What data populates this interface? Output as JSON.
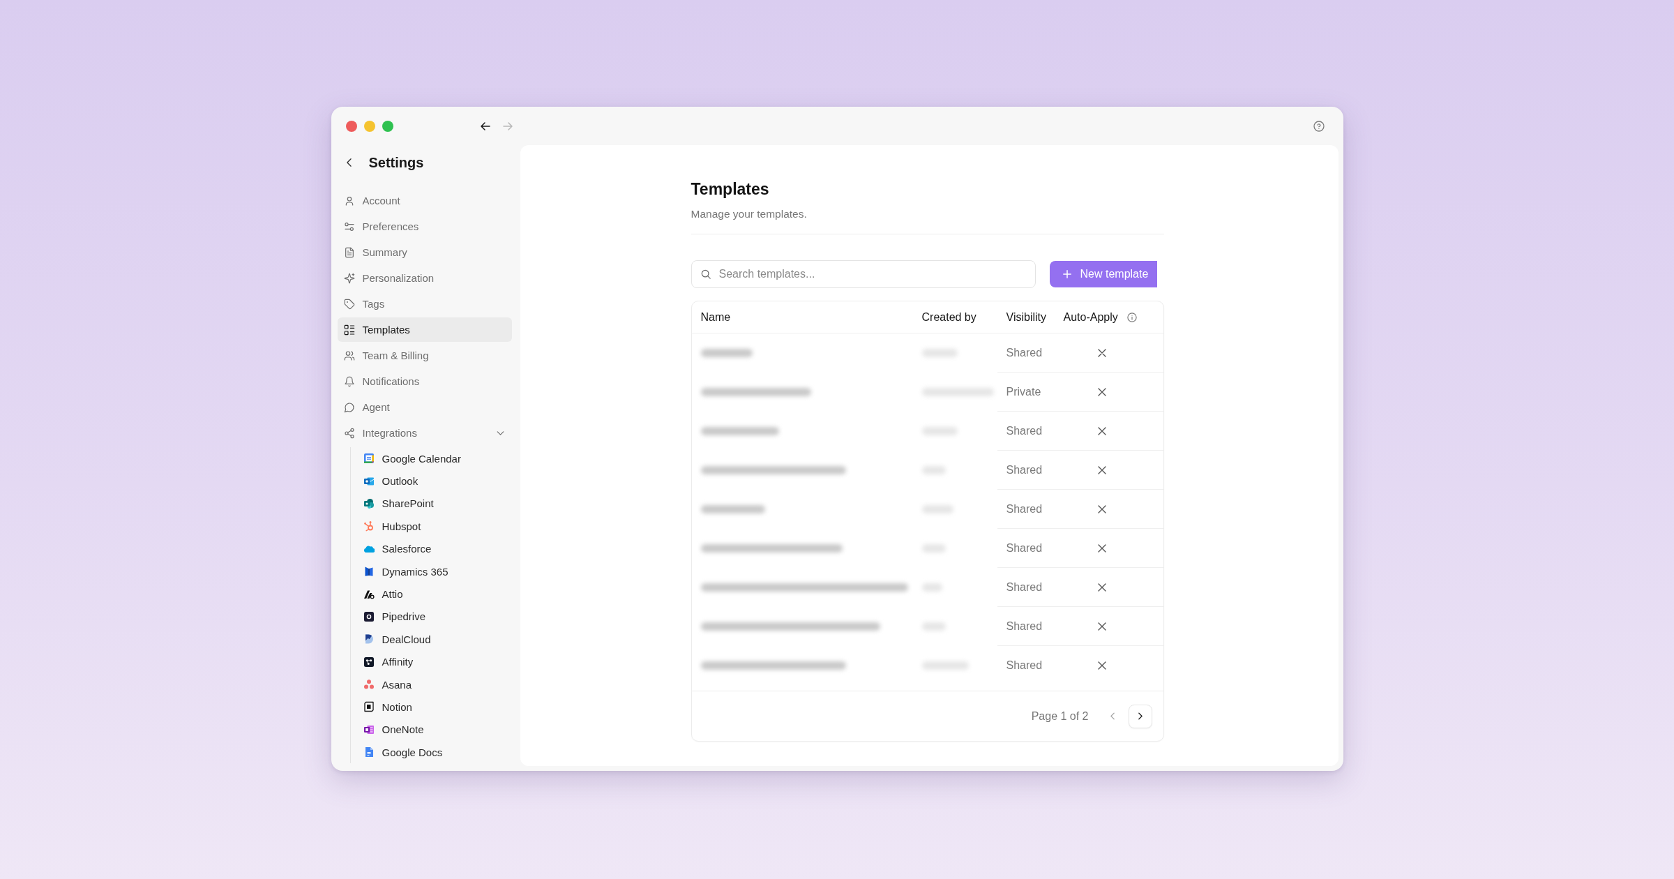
{
  "toolbar": {
    "back": {
      "disabled": false
    },
    "forward": {
      "disabled": true
    }
  },
  "sidebar": {
    "title": "Settings",
    "items": [
      {
        "label": "Account",
        "selected": false
      },
      {
        "label": "Preferences",
        "selected": false
      },
      {
        "label": "Summary",
        "selected": false
      },
      {
        "label": "Personalization",
        "selected": false
      },
      {
        "label": "Tags",
        "selected": false
      },
      {
        "label": "Templates",
        "selected": true
      },
      {
        "label": "Team & Billing",
        "selected": false
      },
      {
        "label": "Notifications",
        "selected": false
      },
      {
        "label": "Agent",
        "selected": false
      },
      {
        "label": "Integrations",
        "selected": false,
        "expanded": true,
        "children": [
          {
            "label": "Google Calendar",
            "selected": false
          },
          {
            "label": "Outlook",
            "selected": false
          },
          {
            "label": "SharePoint",
            "selected": false
          },
          {
            "label": "Hubspot",
            "selected": false
          },
          {
            "label": "Salesforce",
            "selected": false
          },
          {
            "label": "Dynamics 365",
            "selected": false
          },
          {
            "label": "Attio",
            "selected": false
          },
          {
            "label": "Pipedrive",
            "selected": false
          },
          {
            "label": "DealCloud",
            "selected": false
          },
          {
            "label": "Affinity",
            "selected": false
          },
          {
            "label": "Asana",
            "selected": false
          },
          {
            "label": "Notion",
            "selected": false
          },
          {
            "label": "OneNote",
            "selected": false
          },
          {
            "label": "Google Docs",
            "selected": false
          }
        ]
      }
    ]
  },
  "page": {
    "title": "Templates",
    "subtitle": "Manage your templates."
  },
  "search": {
    "placeholder": "Search templates..."
  },
  "new_button": {
    "label": "New template"
  },
  "table": {
    "columns": [
      {
        "label": "Name",
        "info": false
      },
      {
        "label": "Created by",
        "info": false
      },
      {
        "label": "Visibility",
        "info": false
      },
      {
        "label": "Auto-Apply",
        "info": true
      }
    ],
    "rows": [
      {
        "visibility": "Shared",
        "auto_apply": false
      },
      {
        "visibility": "Private",
        "auto_apply": false
      },
      {
        "visibility": "Shared",
        "auto_apply": false
      },
      {
        "visibility": "Shared",
        "auto_apply": false
      },
      {
        "visibility": "Shared",
        "auto_apply": false
      },
      {
        "visibility": "Shared",
        "auto_apply": false
      },
      {
        "visibility": "Shared",
        "auto_apply": false
      },
      {
        "visibility": "Shared",
        "auto_apply": false
      },
      {
        "visibility": "Shared",
        "auto_apply": false
      }
    ]
  },
  "pagination": {
    "label": "Page 1 of 2",
    "previous": {
      "disabled": true
    },
    "next": {
      "disabled": false
    }
  }
}
